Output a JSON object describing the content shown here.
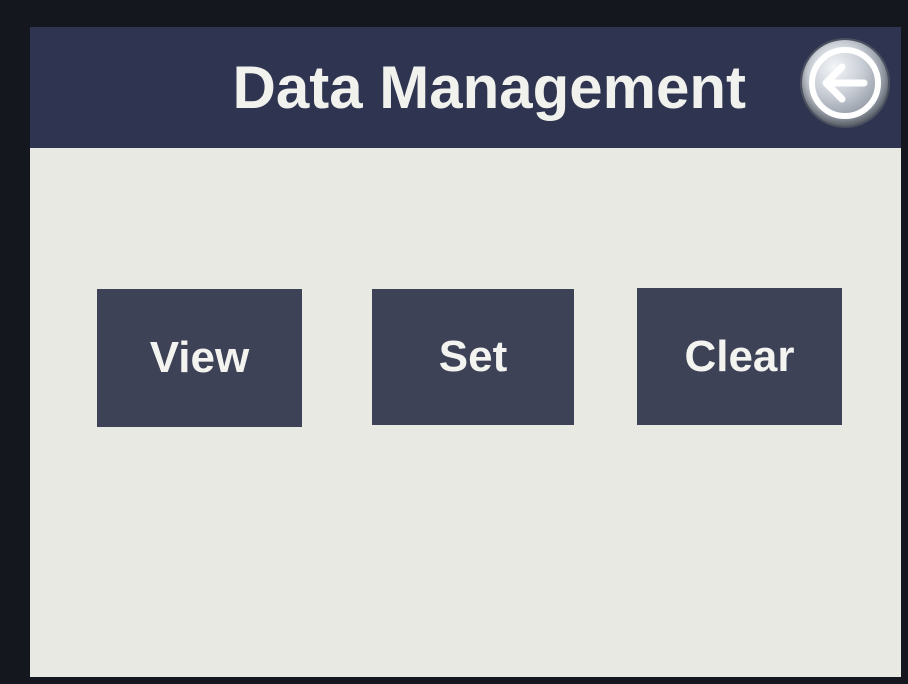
{
  "header": {
    "title": "Data Management",
    "back_icon": "arrow-left-icon"
  },
  "actions": {
    "view_label": "View",
    "set_label": "Set",
    "clear_label": "Clear"
  },
  "colors": {
    "header_bg": "#2f3550",
    "button_bg": "#3d4257",
    "screen_bg": "#e9e9e3",
    "text": "#f1f1ee"
  }
}
